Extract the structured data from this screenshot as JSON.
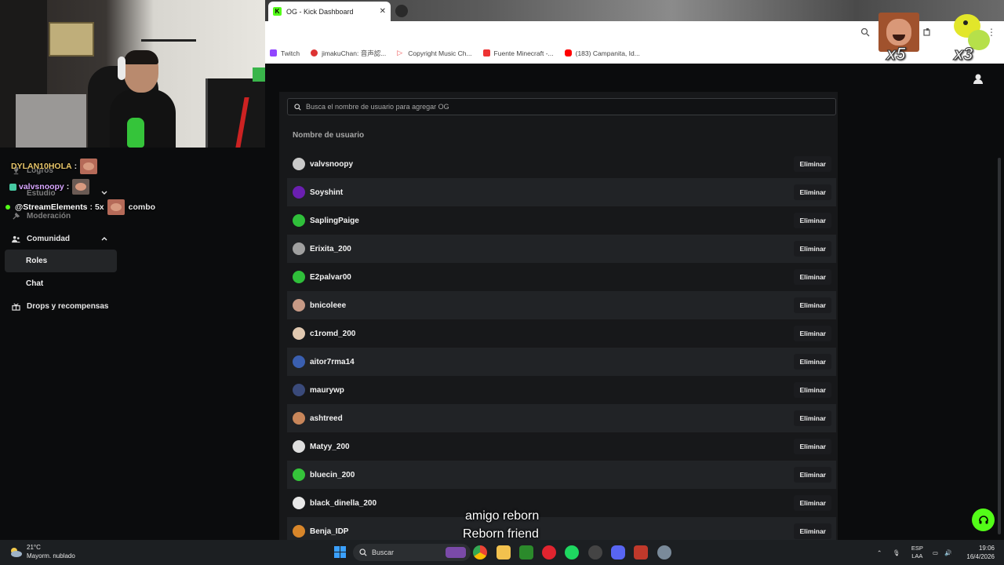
{
  "browser": {
    "tab_title": "OG - Kick Dashboard",
    "tab_icon": "kick-logo-icon",
    "bookmarks": [
      {
        "label": "Twitch",
        "icon": "twitch-icon",
        "color": "#9146ff"
      },
      {
        "label": "jimakuChan: 音声認...",
        "icon": "jimaku-icon",
        "color": "#d33"
      },
      {
        "label": "Copyright Music Ch...",
        "icon": "play-icon",
        "color": "#e55"
      },
      {
        "label": "Fuente Minecraft -...",
        "icon": "font-icon",
        "color": "#e33"
      },
      {
        "label": "(183) Campanita, Id...",
        "icon": "youtube-icon",
        "color": "#f00"
      }
    ]
  },
  "overlay": {
    "emote1_count": "x5",
    "emote2_count": "x3",
    "chat": [
      {
        "user": "DYLAN10HOLA",
        "sep": ":",
        "color": "#e8c66a"
      },
      {
        "user": "valvsnoopy",
        "sep": ":",
        "color": "#d8a6ff"
      },
      {
        "user": "@StreamElements",
        "sep": ": 5x",
        "extra": "combo",
        "color": "#ffffff"
      }
    ],
    "subtitle_es": "amigo reborn",
    "subtitle_en": "Reborn friend"
  },
  "sidebar": {
    "logros": "Logros",
    "estudio": "Estudio",
    "moderacion": "Moderación",
    "comunidad": "Comunidad",
    "roles": "Roles",
    "chat": "Chat",
    "drops": "Drops y recompensas"
  },
  "og": {
    "search_placeholder": "Busca el nombre de usuario para agregar OG",
    "column_header": "Nombre de usuario",
    "remove_label": "Eliminar",
    "users": [
      {
        "name": "valvsnoopy",
        "color": "#c9c9c9"
      },
      {
        "name": "Soyshint",
        "color": "#6a1fb0"
      },
      {
        "name": "SaplingPaige",
        "color": "#2fbf3a"
      },
      {
        "name": "Erixita_200",
        "color": "#a0a0a0"
      },
      {
        "name": "E2palvar00",
        "color": "#2fbf3a"
      },
      {
        "name": "bnicoleee",
        "color": "#c79a86"
      },
      {
        "name": "c1romd_200",
        "color": "#e0c8b0"
      },
      {
        "name": "aitor7rma14",
        "color": "#3a5fb0"
      },
      {
        "name": "maurywp",
        "color": "#3a4a7a"
      },
      {
        "name": "ashtreed",
        "color": "#c8865a"
      },
      {
        "name": "Matyy_200",
        "color": "#dedede"
      },
      {
        "name": "bluecin_200",
        "color": "#35c43a"
      },
      {
        "name": "black_dinella_200",
        "color": "#e8e8e8"
      },
      {
        "name": "Benja_IDP",
        "color": "#d8862a"
      }
    ]
  },
  "taskbar": {
    "temp": "21°C",
    "weather": "Mayorm. nublado",
    "search": "Buscar",
    "lang1": "ESP",
    "lang2": "LAA",
    "time": "19:06",
    "date": "16/4/2026"
  }
}
